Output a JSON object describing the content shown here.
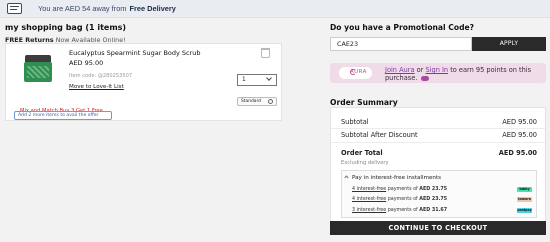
{
  "banner": {
    "icon": "delivery-truck-icon",
    "text": "You are AED 54 away from",
    "strong": "Free Delivery"
  },
  "bag": {
    "title": "my shopping bag (1 items)",
    "free_returns": "FREE Returns",
    "free_returns_sub": "Now Available Online!",
    "item": {
      "name": "Eucalyptus Spearmint Sugar Body Scrub",
      "price": "AED 95.00",
      "code": "Item code: @280253507",
      "move_link": "Move to Love-It List",
      "quantity": "1",
      "promo_message": "Mix and Match Buy 3 Get 1 Free",
      "delivery_option": "Standard",
      "add_more": "Add 2 more items to avail the offer"
    }
  },
  "promo": {
    "question": "Do you have a Promotional Code?",
    "code_value": "CAE23",
    "apply_label": "APPLY"
  },
  "aura": {
    "logo": "AURA",
    "join_link": "Join Aura",
    "or": "or",
    "signin_link": "Sign In",
    "text": "to earn 95 points on this purchase."
  },
  "summary": {
    "title": "Order Summary",
    "subtotal_label": "Subtotal",
    "subtotal_value": "AED 95.00",
    "after_discount_label": "Subtotal After Discount",
    "after_discount_value": "AED 95.00",
    "total_label": "Order Total",
    "total_value": "AED 95.00",
    "excluding": "Excluding delivery",
    "installments": {
      "header": "Pay in interest-free installments",
      "rows": [
        {
          "lead": "4 interest-free",
          "mid": "payments of",
          "amount": "AED 23.75",
          "provider": "tabby",
          "color": "#3ee6a8"
        },
        {
          "lead": "4 interest-free",
          "mid": "payments of",
          "amount": "AED 23.75",
          "provider": "tamara",
          "color": "#f5c3a4"
        },
        {
          "lead": "3 interest-free",
          "mid": "payments of",
          "amount": "AED 31.67",
          "provider": "postpay",
          "color": "#4ad3e8"
        }
      ]
    },
    "checkout_label": "CONTINUE TO CHECKOUT"
  }
}
